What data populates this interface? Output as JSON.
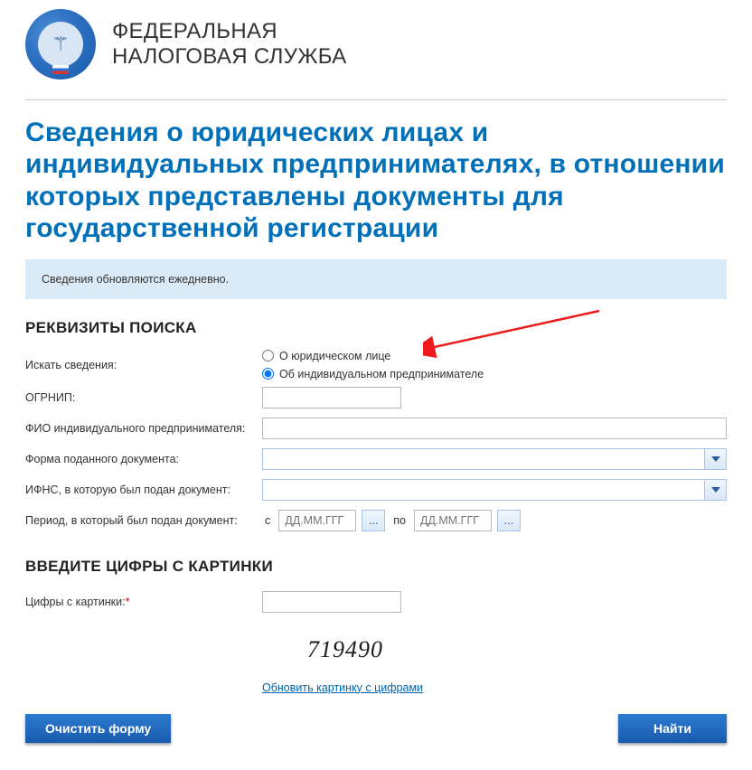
{
  "header": {
    "org_line1": "ФЕДЕРАЛЬНАЯ",
    "org_line2": "НАЛОГОВАЯ СЛУЖБА"
  },
  "page_title": "Сведения о юридических лицах и индивидуальных предпринимателях, в отношении которых представлены документы для государственной регистрации",
  "info_bar": "Сведения обновляются ежедневно.",
  "search": {
    "section_title": "РЕКВИЗИТЫ ПОИСКА",
    "search_label": "Искать сведения:",
    "radio_legal": "О юридическом лице",
    "radio_individual": "Об индивидуальном предпринимателе",
    "ogrnip_label": "ОГРНИП:",
    "fio_label": "ФИО индивидуального предпринимателя:",
    "form_label": "Форма поданного документа:",
    "ifns_label": "ИФНС, в которую был подан документ:",
    "period_label": "Период, в который был подан документ:",
    "period_from": "с",
    "period_to": "по",
    "date_placeholder": "ДД.ММ.ГГГ",
    "date_btn": "..."
  },
  "captcha": {
    "section_title": "ВВЕДИТЕ ЦИФРЫ С КАРТИНКИ",
    "label": "Цифры с картинки:",
    "image_text": "719490",
    "refresh_link": "Обновить картинку с цифрами"
  },
  "buttons": {
    "clear": "Очистить форму",
    "find": "Найти"
  }
}
